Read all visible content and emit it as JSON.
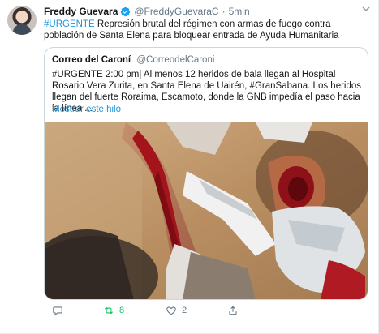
{
  "tweet": {
    "author_name": "Freddy Guevara",
    "author_handle": "@FreddyGuevaraC",
    "separator": "·",
    "time": "5min",
    "hashtag": "#URGENTE",
    "text": " Represión brutal del régimen con armas de fuego contra población de Santa Elena para bloquear entrada de Ayuda Humanitaria"
  },
  "quote": {
    "author_name": "Correo del Caroní",
    "author_handle": "@CorreodelCaroni",
    "text": "#URGENTE 2:00 pm| Al menos 12 heridos de bala llegan al Hospital Rosario Vera Zurita, en Santa Elena de Uairén, #GranSabana. Los heridos llegan del fuerte Roraima, Escamoto, donde la GNB impedía el paso hacia la línea ...",
    "show_thread": "Mostrar este hilo"
  },
  "actions": {
    "reply_count": "",
    "retweet_count": "8",
    "like_count": "2"
  },
  "colors": {
    "link": "#1b95e0",
    "retweet": "#17bf63",
    "muted": "#657786",
    "border": "#ccd6dd"
  },
  "icons": [
    "verified-badge-icon",
    "chevron-down-icon",
    "reply-icon",
    "retweet-icon",
    "like-icon",
    "share-icon"
  ]
}
